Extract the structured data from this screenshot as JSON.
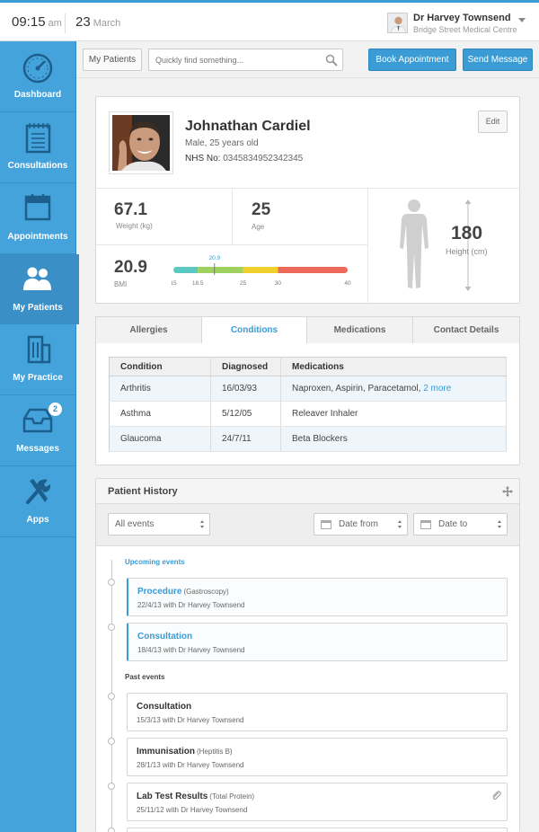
{
  "topbar": {
    "time": "09:15",
    "ampm": "am",
    "day": "23",
    "month": "March",
    "user_name": "Dr Harvey Townsend",
    "user_org": "Bridge Street Medical Centre"
  },
  "sidebar": {
    "items": [
      {
        "label": "Dashboard",
        "icon": "gauge-icon"
      },
      {
        "label": "Consultations",
        "icon": "notepad-icon"
      },
      {
        "label": "Appointments",
        "icon": "calendar-icon"
      },
      {
        "label": "My Patients",
        "icon": "users-icon",
        "active": true
      },
      {
        "label": "My Practice",
        "icon": "building-icon"
      },
      {
        "label": "Messages",
        "icon": "inbox-icon",
        "badge": "2"
      },
      {
        "label": "Apps",
        "icon": "tools-icon"
      }
    ]
  },
  "toolbar": {
    "my_patients": "My Patients",
    "search_placeholder": "Quickly find something...",
    "book": "Book Appointment",
    "send": "Send Message"
  },
  "patient": {
    "name": "Johnathan Cardiel",
    "sub": "Male, 25 years old",
    "nhs_label": "NHS No:",
    "nhs": "0345834952342345",
    "edit": "Edit",
    "weight": "67.1",
    "weight_label": "Weight (kg)",
    "age": "25",
    "age_label": "Age",
    "bmi": "20.9",
    "bmi_label": "BMI",
    "bmi_marker": "20.9",
    "bmi_marker_value": 20.9,
    "bmi_scale": [
      "15",
      "18.5",
      "25",
      "30",
      "40"
    ],
    "bmi_colors": [
      "#5bc8c4",
      "#9fd15e",
      "#f0d02a",
      "#ec6a5c"
    ],
    "height": "180",
    "height_label": "Height (cm)"
  },
  "tabs": [
    {
      "label": "Allergies"
    },
    {
      "label": "Conditions",
      "active": true
    },
    {
      "label": "Medications"
    },
    {
      "label": "Contact Details"
    }
  ],
  "conditions": {
    "headers": [
      "Condition",
      "Diagnosed",
      "Medications"
    ],
    "rows": [
      {
        "condition": "Arthritis",
        "diagnosed": "16/03/93",
        "medications": "Naproxen, Aspirin, Paracetamol,",
        "more": "2 more"
      },
      {
        "condition": "Asthma",
        "diagnosed": "5/12/05",
        "medications": "Releaver Inhaler",
        "more": ""
      },
      {
        "condition": "Glaucoma",
        "diagnosed": "24/7/11",
        "medications": "Beta Blockers",
        "more": ""
      }
    ]
  },
  "history": {
    "title": "Patient History",
    "filter_all": "All events",
    "date_from": "Date from",
    "date_to": "Date to",
    "upcoming_label": "Upcoming events",
    "past_label": "Past events",
    "upcoming": [
      {
        "title": "Procedure",
        "detail": "(Gastroscopy)",
        "sub": "22/4/13 with Dr Harvey Townsend"
      },
      {
        "title": "Consultation",
        "detail": "",
        "sub": "18/4/13 with Dr Harvey Townsend"
      }
    ],
    "past": [
      {
        "title": "Consultation",
        "detail": "",
        "sub": "15/3/13 with Dr Harvey Townsend"
      },
      {
        "title": "Immunisation",
        "detail": "(Heptitis B)",
        "sub": "28/1/13 with Dr Harvey Townsend"
      },
      {
        "title": "Lab Test Results",
        "detail": "(Total Protein)",
        "sub": "25/11/12 with Dr Harvey Townsend",
        "attachment": true
      }
    ]
  },
  "colors": {
    "accent": "#3a9bd5",
    "sidebar": "#45a3db",
    "sidebar_active": "#3a8fc7"
  }
}
